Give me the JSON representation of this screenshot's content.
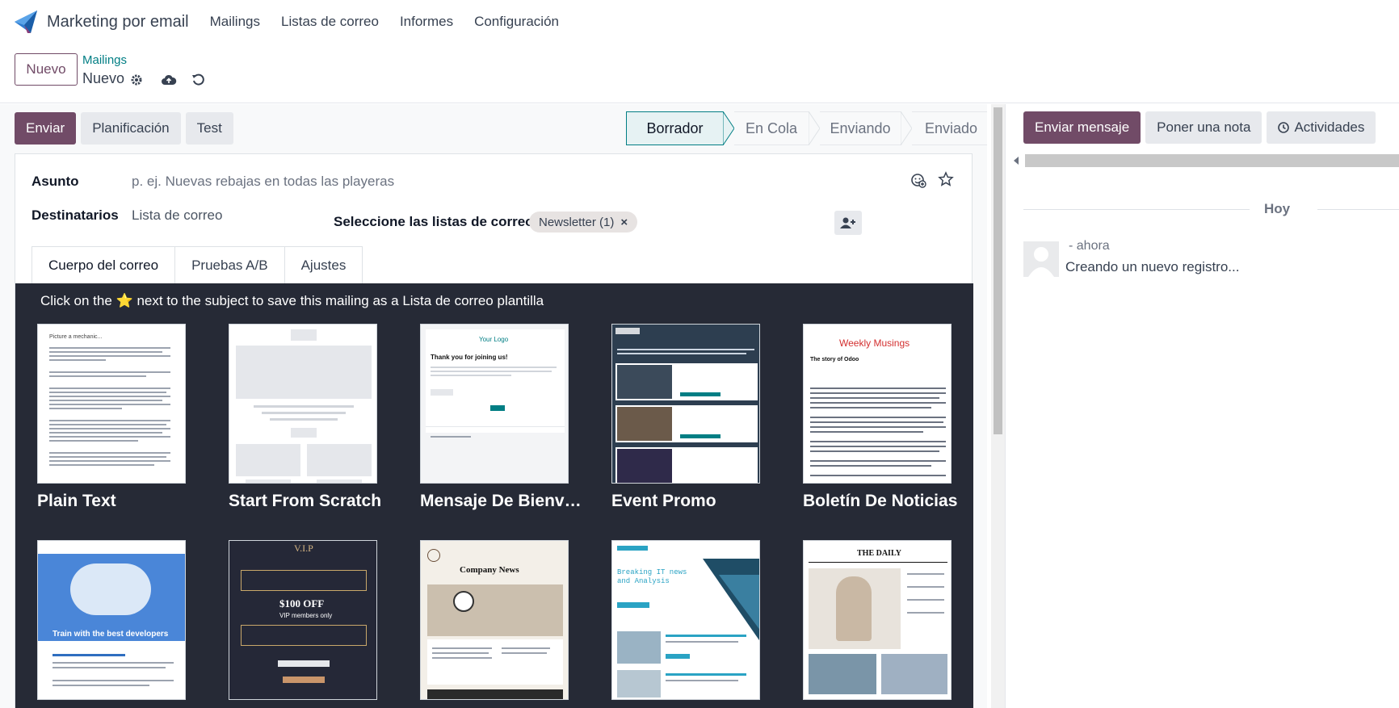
{
  "navbar": {
    "app_title": "Marketing por email",
    "menu": [
      "Mailings",
      "Listas de correo",
      "Informes",
      "Configuración"
    ]
  },
  "control": {
    "new_label": "Nuevo",
    "breadcrumb_parent": "Mailings",
    "breadcrumb_current": "Nuevo"
  },
  "actions": {
    "send": "Enviar",
    "schedule": "Planificación",
    "test": "Test"
  },
  "status": {
    "stages": [
      "Borrador",
      "En Cola",
      "Enviando",
      "Enviado"
    ],
    "active": "Borrador"
  },
  "form": {
    "subject_label": "Asunto",
    "subject_placeholder": "p. ej. Nuevas rebajas en todas las playeras",
    "recipients_label": "Destinatarios",
    "recipients_value": "Lista de correo",
    "lists_label": "Seleccione las listas de correo:",
    "list_tag": "Newsletter (1)",
    "tag_remove": "×"
  },
  "tabs": [
    "Cuerpo del correo",
    "Pruebas A/B",
    "Ajustes"
  ],
  "body": {
    "hint_before": "Click on the",
    "hint_star": "⭐",
    "hint_after": "next to the subject to save this mailing as a Lista de correo plantilla"
  },
  "templates": [
    {
      "label": "Plain Text"
    },
    {
      "label": "Start From Scratch"
    },
    {
      "label": "Mensaje De Bienvenida"
    },
    {
      "label": "Event Promo"
    },
    {
      "label": "Boletín De Noticias"
    }
  ],
  "templates_row2": [
    {
      "caption": "Train with the best developers"
    },
    {
      "caption": "$100 OFF",
      "sub": "VIP members only",
      "title": "V.I.P"
    },
    {
      "caption": "Company News"
    },
    {
      "caption": "Breaking IT news and Analysis"
    },
    {
      "caption": "THE DAILY"
    }
  ],
  "thumb_texts": {
    "plain": "Picture a mechanic...",
    "welcome_logo": "Your Logo",
    "welcome_title": "Thank you for joining us!",
    "musings": "Weekly Musings",
    "musings_sub": "The story of Odoo"
  },
  "chatter": {
    "send_message": "Enviar mensaje",
    "log_note": "Poner una nota",
    "activities": "Actividades",
    "day": "Hoy",
    "msg_meta": "- ahora",
    "msg_body": "Creando un nuevo registro..."
  },
  "colors": {
    "primary": "#714b67",
    "teal": "#017e84",
    "dark_bg": "#262a36"
  }
}
